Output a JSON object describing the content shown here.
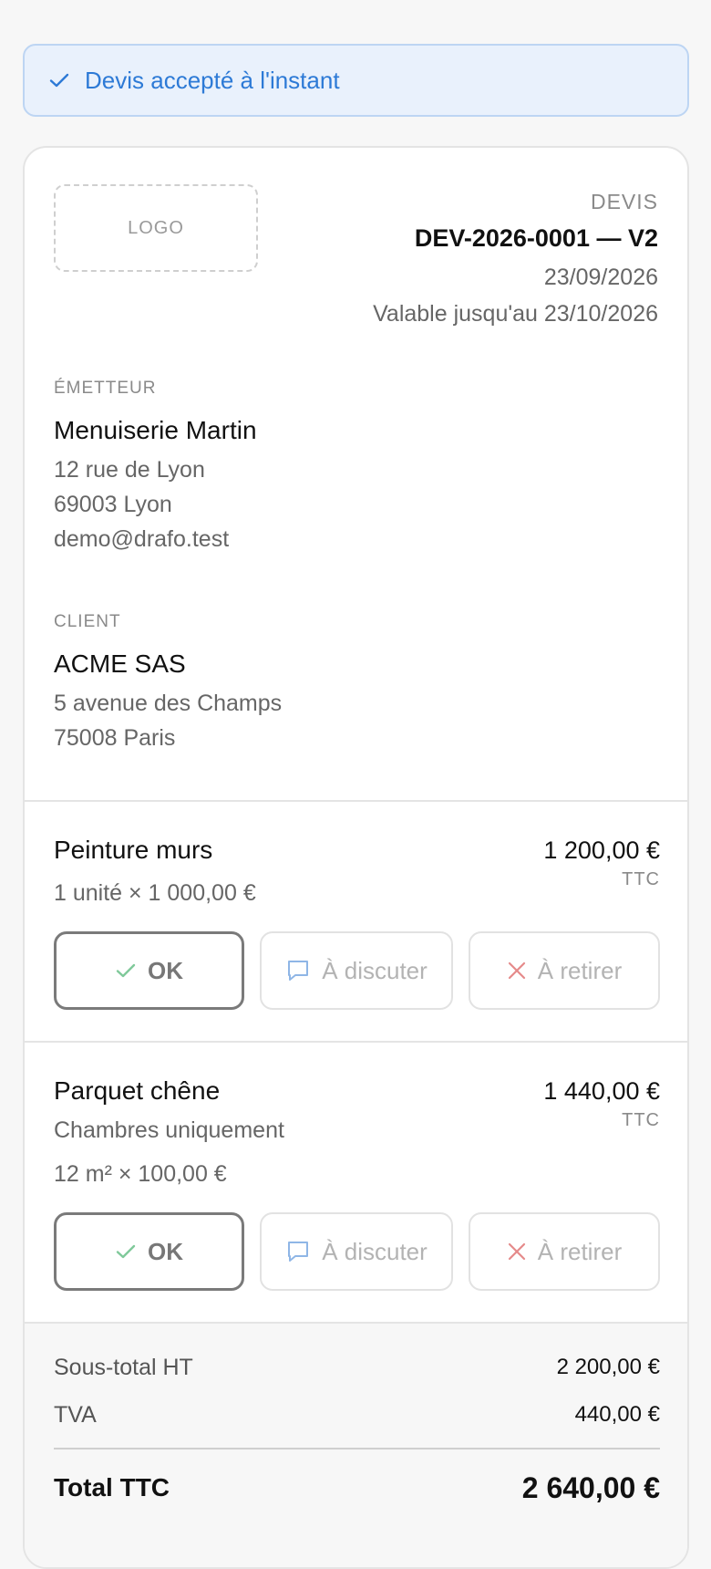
{
  "banner": {
    "message": "Devis accepté à l'instant",
    "icon": "check-icon",
    "color": "#2d7ad6"
  },
  "header": {
    "logo_placeholder": "LOGO",
    "doc_type": "DEVIS",
    "doc_number": "DEV-2026-0001 — V2",
    "date": "23/09/2026",
    "validity": "Valable jusqu'au 23/10/2026"
  },
  "issuer": {
    "label": "ÉMETTEUR",
    "name": "Menuiserie Martin",
    "address_line1": "12 rue de Lyon",
    "address_line2": "69003 Lyon",
    "email": "demo@drafo.test"
  },
  "client": {
    "label": "CLIENT",
    "name": "ACME SAS",
    "address_line1": "5 avenue des Champs",
    "address_line2": "75008 Paris"
  },
  "items": [
    {
      "title": "Peinture murs",
      "description": "",
      "quantity_line": "1 unité × 1 000,00 €",
      "price": "1 200,00 €",
      "price_tax_label": "TTC",
      "buttons": {
        "ok": "OK",
        "discuss": "À discuter",
        "remove": "À retirer"
      }
    },
    {
      "title": "Parquet chêne",
      "description": "Chambres uniquement",
      "quantity_line": "12 m² × 100,00 €",
      "price": "1 440,00 €",
      "price_tax_label": "TTC",
      "buttons": {
        "ok": "OK",
        "discuss": "À discuter",
        "remove": "À retirer"
      }
    }
  ],
  "totals": {
    "subtotal_label": "Sous-total HT",
    "subtotal_value": "2 200,00 €",
    "tax_label": "TVA",
    "tax_value": "440,00 €",
    "total_label": "Total TTC",
    "total_value": "2 640,00 €"
  },
  "colors": {
    "accent_blue": "#2d7ad6",
    "ok_green": "#7fc99a",
    "discuss_blue": "#8fb6e6",
    "remove_red": "#e58a8a"
  }
}
